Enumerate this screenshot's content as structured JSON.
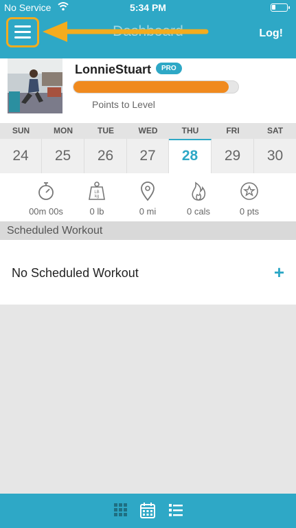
{
  "status_bar": {
    "carrier": "No Service",
    "time": "5:34 PM",
    "battery_level": 0.2
  },
  "header": {
    "title": "Dashboard",
    "logout_label": "Log!"
  },
  "profile": {
    "username": "LonnieStuart",
    "badge": "PRO",
    "progress_label": "Points to Level",
    "progress": 0.94
  },
  "calendar": {
    "days": [
      {
        "name": "SUN",
        "num": "24",
        "active": false
      },
      {
        "name": "MON",
        "num": "25",
        "active": false
      },
      {
        "name": "TUE",
        "num": "26",
        "active": false
      },
      {
        "name": "WED",
        "num": "27",
        "active": false
      },
      {
        "name": "THU",
        "num": "28",
        "active": true
      },
      {
        "name": "FRI",
        "num": "29",
        "active": false
      },
      {
        "name": "SAT",
        "num": "30",
        "active": false
      }
    ]
  },
  "stats": [
    {
      "icon": "stopwatch-icon",
      "value": "00m 00s"
    },
    {
      "icon": "weight-icon",
      "value": "0 lb"
    },
    {
      "icon": "location-pin-icon",
      "value": "0 mi"
    },
    {
      "icon": "flame-icon",
      "value": "0 cals"
    },
    {
      "icon": "star-icon",
      "value": "0 pts"
    }
  ],
  "scheduled": {
    "section_title": "Scheduled Workout",
    "empty_text": "No Scheduled Workout",
    "add_symbol": "+"
  },
  "bottom_nav": {
    "items": [
      "grid-icon",
      "calendar-icon",
      "list-icon"
    ]
  },
  "colors": {
    "primary": "#2ea8c6",
    "accent": "#f4ac1d",
    "progress": "#f08a1e"
  }
}
